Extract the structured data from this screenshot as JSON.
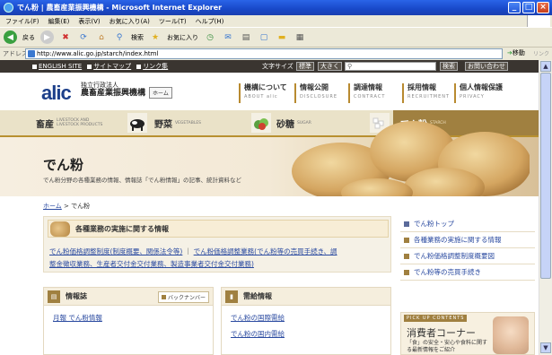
{
  "window": {
    "title": "でん粉 | 農畜産業振興機構 - Microsoft Internet Explorer",
    "minimize": "_",
    "maximize": "□",
    "close": "×"
  },
  "menu": [
    "ファイル(F)",
    "編集(E)",
    "表示(V)",
    "お気に入り(A)",
    "ツール(T)",
    "ヘルプ(H)"
  ],
  "toolbar": {
    "back": "戻る",
    "search": "検索",
    "favorites": "お気に入り"
  },
  "address": {
    "label": "アドレス(D)",
    "url": "http://www.alic.go.jp/starch/index.html",
    "go": "移動",
    "links": "リンク"
  },
  "site_top": {
    "english": "ENGLISH SITE",
    "sitemap": "サイトマップ",
    "links": "リンク集",
    "font_size": "文字サイズ",
    "standard": "標準",
    "large": "大きく",
    "search_btn": "検索",
    "contact": "お問い合わせ"
  },
  "header": {
    "logo": "alic",
    "org_sub": "独立行政法人",
    "org_name": "農畜産業振興機構",
    "home": "ホーム",
    "nav": [
      {
        "label": "機構について",
        "sub": "ABOUT alic"
      },
      {
        "label": "情報公開",
        "sub": "DISCLOSURE"
      },
      {
        "label": "調達情報",
        "sub": "CONTRACT"
      },
      {
        "label": "採用情報",
        "sub": "RECRUITMENT"
      },
      {
        "label": "個人情報保護",
        "sub": "PRIVACY"
      }
    ]
  },
  "categories": [
    {
      "label": "畜産",
      "sub1": "LIVESTOCK AND",
      "sub2": "LIVESTOCK PRODUCTS"
    },
    {
      "label": "野菜",
      "sub1": "VEGETABLES",
      "sub2": ""
    },
    {
      "label": "砂糖",
      "sub1": "SUGAR",
      "sub2": ""
    },
    {
      "label": "でん粉",
      "sub1": "STARCH",
      "sub2": ""
    }
  ],
  "hero": {
    "title": "でん粉",
    "subtitle": "でん粉分野の各種業務の情報、情報誌「でん粉情報」の記事、統計資料など"
  },
  "breadcrumb": {
    "home": "ホーム",
    "sep": ">",
    "current": "でん粉"
  },
  "info_box": {
    "title": "各種業務の実施に関する情報",
    "line1a": "でん粉価格調整制度(制度概要、関係法令等)",
    "sep": "｜",
    "line1b": "でん粉価格調整業務(でん粉等の売買手続き、調",
    "line2": "整金徴収業務、生産者交付金交付業務、製造事業者交付金交付業務)"
  },
  "right_nav": [
    "でん粉トップ",
    "各種業務の実施に関する情報",
    "でん粉価格調整制度概要図",
    "でん粉等の売買手続き"
  ],
  "magazine": {
    "title": "情報誌",
    "back_numbers": "バックナンバー",
    "link": "月報 でん粉情報"
  },
  "supply": {
    "title": "需給情報",
    "link1": "でん粉の国際需給",
    "link2": "でん粉の国内需給"
  },
  "pickup": {
    "tag": "PICK UP CONTENTS",
    "title": "消費者コーナー",
    "desc": "「食」の安全・安心や食料に関する最新情報をご紹介"
  }
}
